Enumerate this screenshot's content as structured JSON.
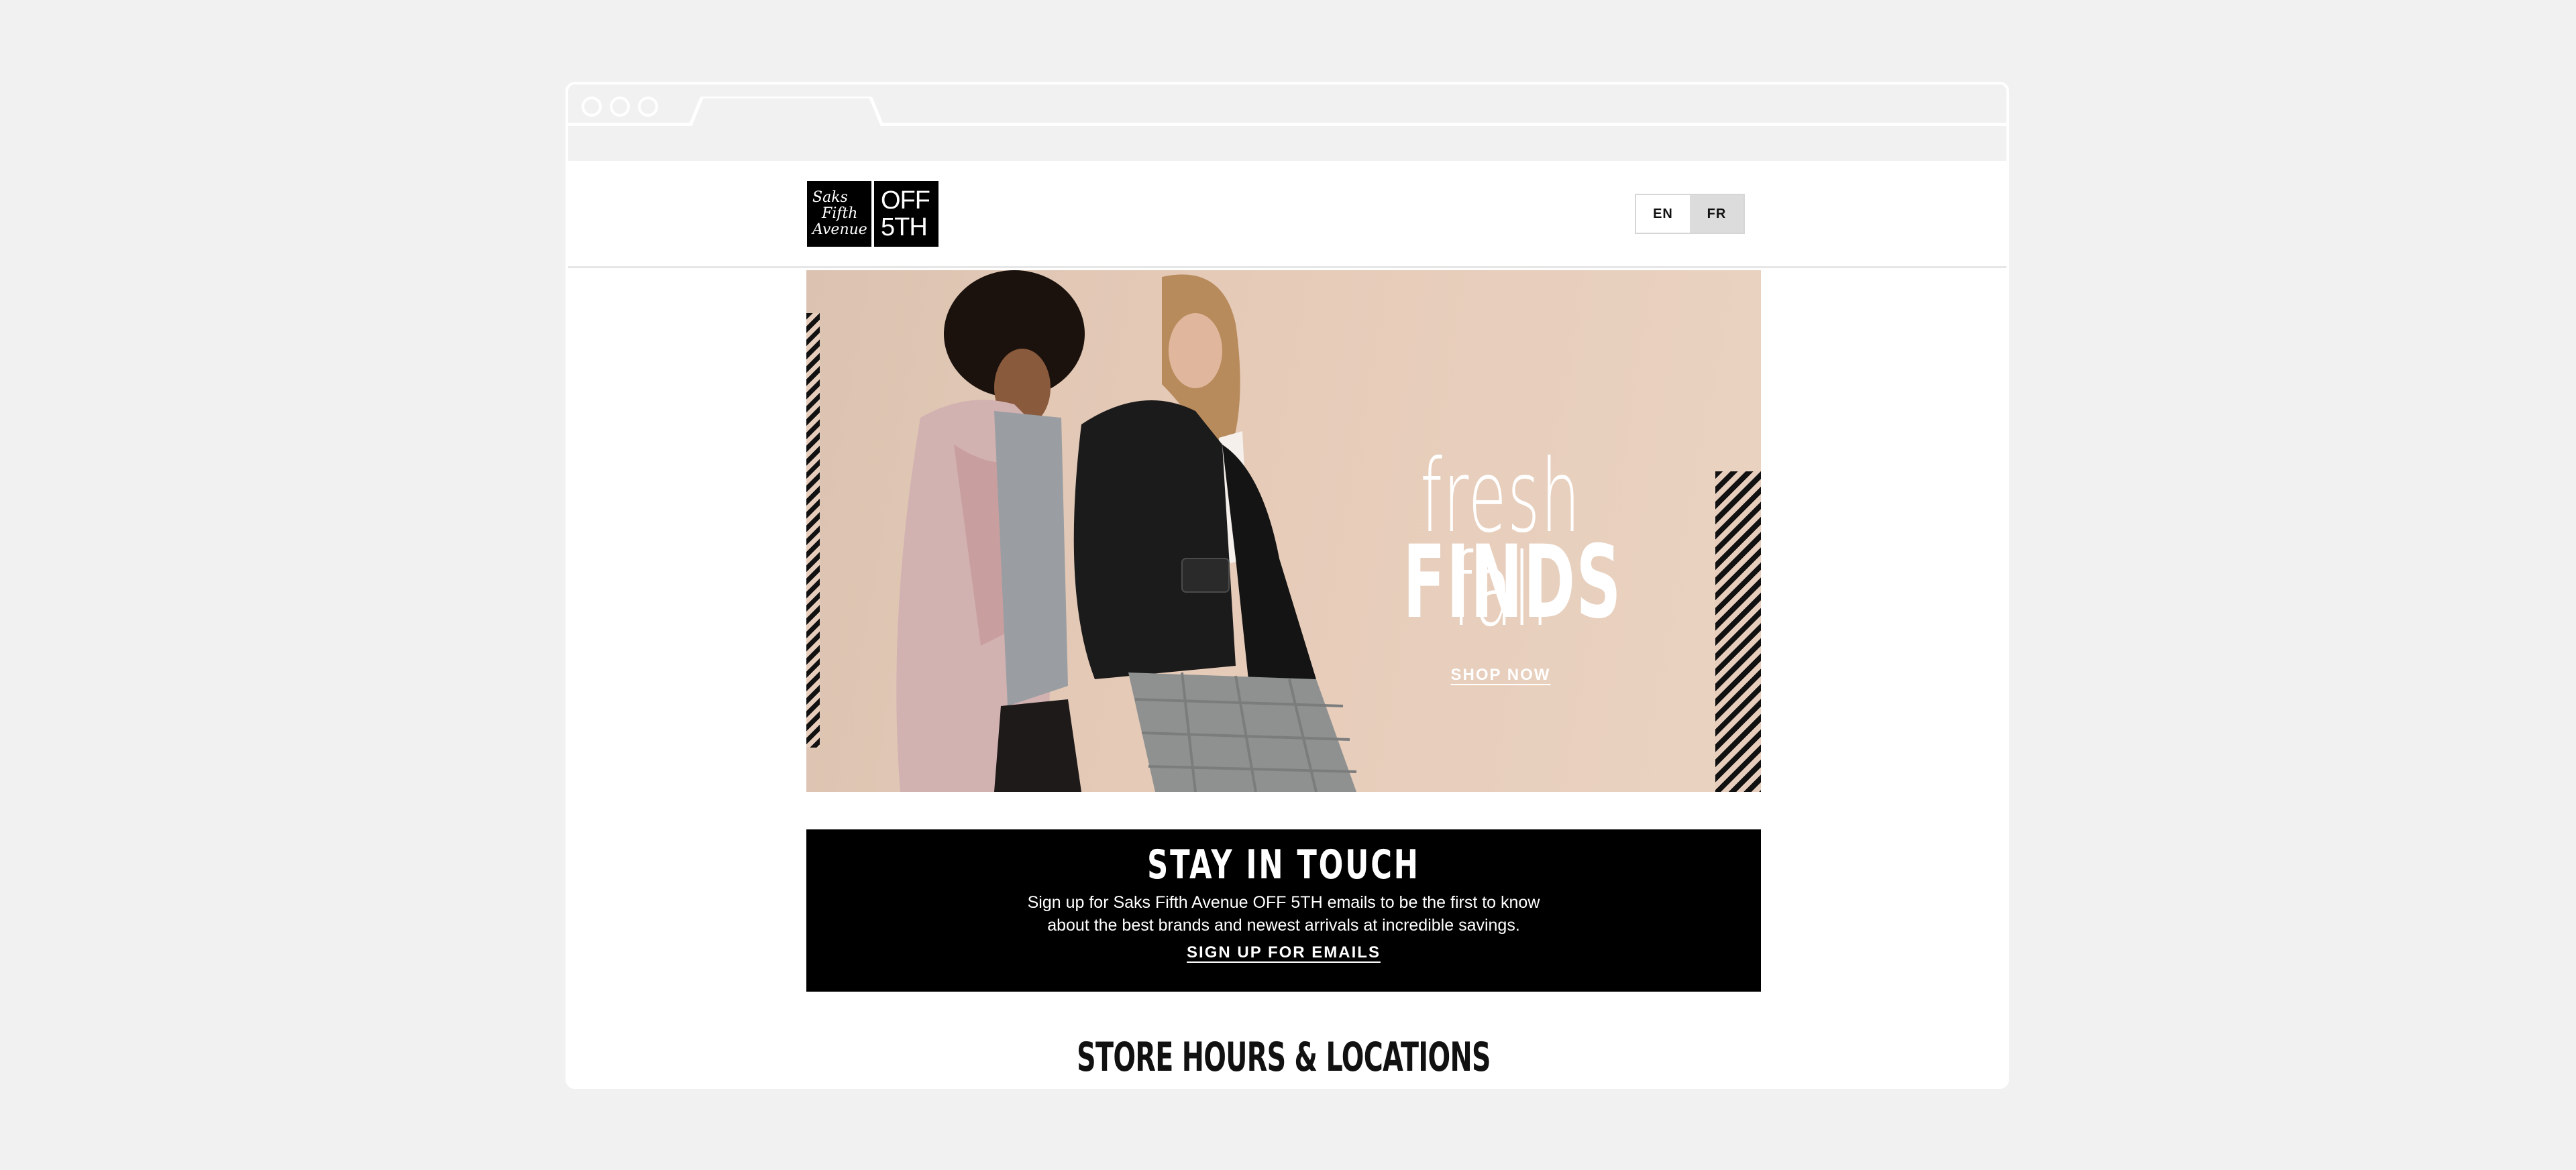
{
  "header": {
    "logo": {
      "saks_lines": [
        "Saks",
        "Fifth",
        "Avenue"
      ],
      "off5_lines": [
        "OFF",
        "5TH"
      ]
    },
    "language": {
      "en": "EN",
      "fr": "FR"
    }
  },
  "hero": {
    "title_line1": "fresh fall",
    "title_line2": "FINDS",
    "cta": "SHOP NOW"
  },
  "signup": {
    "title": "STAY IN TOUCH",
    "text_line1": "Sign up for Saks Fifth Avenue OFF 5TH emails to be the first to know",
    "text_line2": "about the best brands and newest arrivals at incredible savings.",
    "cta": "SIGN UP FOR EMAILS"
  },
  "store": {
    "title": "STORE HOURS & LOCATIONS"
  },
  "colors": {
    "page_bg": "#f1f1f1",
    "hero_bg": "#e6cbb8",
    "signup_bg": "#000000",
    "text_primary": "#111111"
  }
}
